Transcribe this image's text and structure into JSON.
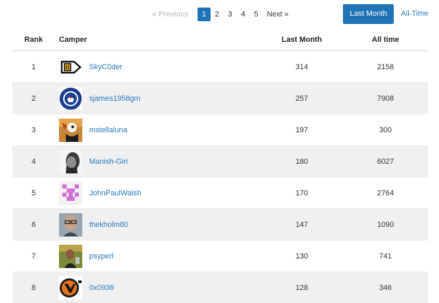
{
  "pagination": {
    "previous_label": "« Previous",
    "pages": [
      "1",
      "2",
      "3",
      "4",
      "5"
    ],
    "current_page": "1",
    "next_label": "Next »"
  },
  "toggle": {
    "last_month_label": "Last Month",
    "all_time_label": "All-Time",
    "active": "Last Month"
  },
  "table": {
    "headers": {
      "rank": "Rank",
      "camper": "Camper",
      "last_month": "Last Month",
      "all_time": "All time"
    },
    "rows": [
      {
        "rank": "1",
        "name": "SkyC0der",
        "last_month": "314",
        "all_time": "2158",
        "avatar_icon": "code-tag-avatar"
      },
      {
        "rank": "2",
        "name": "sjames1958gm",
        "last_month": "257",
        "all_time": "7908",
        "avatar_icon": "football-crest-avatar"
      },
      {
        "rank": "3",
        "name": "mstellaluna",
        "last_month": "197",
        "all_time": "300",
        "avatar_icon": "cartoon-character-avatar"
      },
      {
        "rank": "4",
        "name": "Manish-Giri",
        "last_month": "180",
        "all_time": "6027",
        "avatar_icon": "person-photo-avatar"
      },
      {
        "rank": "5",
        "name": "JohnPaulWalsh",
        "last_month": "170",
        "all_time": "2764",
        "avatar_icon": "pixel-identicon-avatar"
      },
      {
        "rank": "6",
        "name": "thekholm80",
        "last_month": "147",
        "all_time": "1090",
        "avatar_icon": "person-glasses-avatar"
      },
      {
        "rank": "7",
        "name": "psyperl",
        "last_month": "130",
        "all_time": "741",
        "avatar_icon": "person-photo-avatar"
      },
      {
        "rank": "8",
        "name": "0x0936",
        "last_month": "128",
        "all_time": "346",
        "avatar_icon": "half-life-logo-avatar"
      }
    ]
  },
  "colors": {
    "accent": "#1f73b7",
    "link": "#2a78b8",
    "stripe": "#f0f0f0"
  }
}
